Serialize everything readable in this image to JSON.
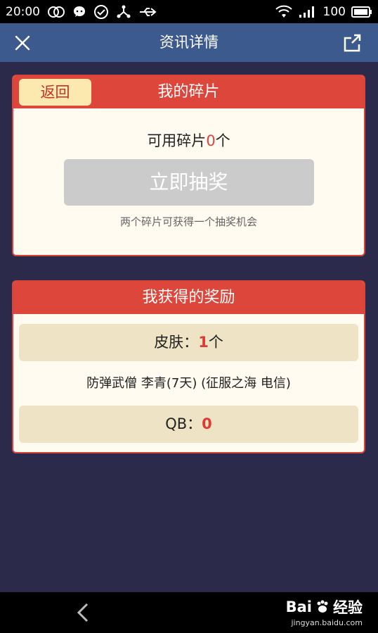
{
  "status_bar": {
    "time": "20:00",
    "battery": "100"
  },
  "header": {
    "title": "资讯详情"
  },
  "fragments": {
    "title": "我的碎片",
    "back_label": "返回",
    "available_prefix": "可用碎片",
    "available_count": "0",
    "available_suffix": "个",
    "draw_button": "立即抽奖",
    "hint": "两个碎片可获得一个抽奖机会"
  },
  "rewards": {
    "title": "我获得的奖励",
    "skin_label": "皮肤：",
    "skin_count": "1",
    "skin_suffix": "个",
    "skin_desc": "防弹武僧 李青(7天)  (征服之海 电信)",
    "qb_label": "QB：",
    "qb_value": "0"
  },
  "watermark": {
    "brand": "Bai",
    "brand_suffix": "经验",
    "url": "jingyan.baidu.com"
  }
}
